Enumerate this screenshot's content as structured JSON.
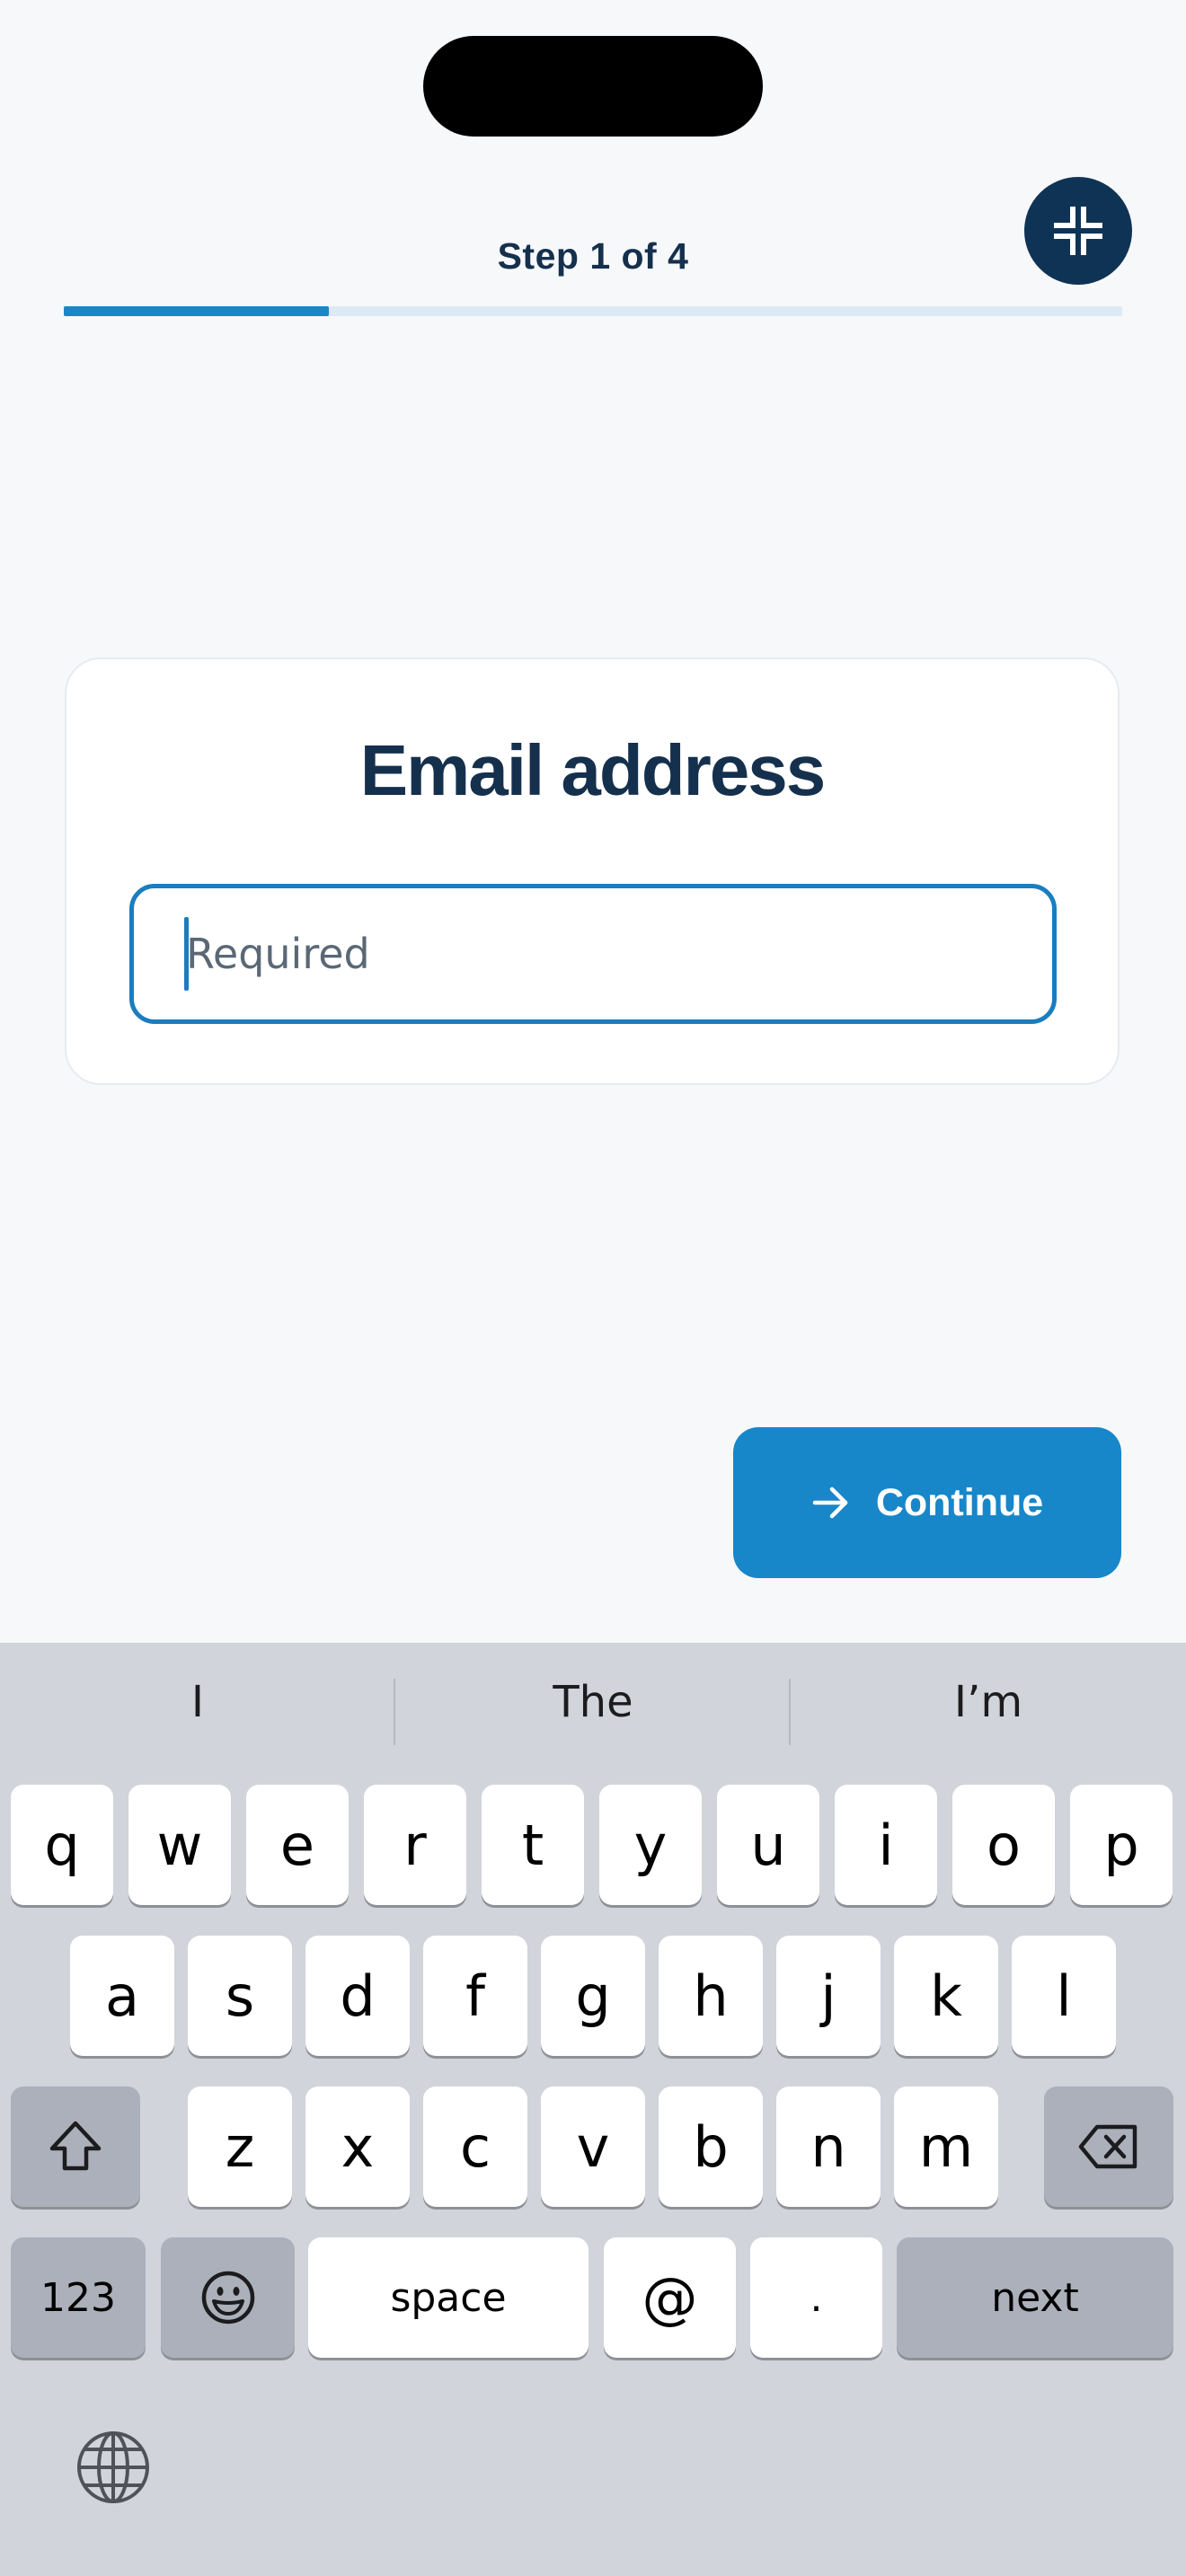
{
  "header": {
    "step_label": "Step 1 of 4",
    "progress_fraction": 0.25,
    "collapse_icon": "collapse-arrows-icon"
  },
  "form": {
    "title": "Email address",
    "email_placeholder": "Required"
  },
  "actions": {
    "continue_label": "Continue",
    "continue_icon": "arrow-right-icon"
  },
  "keyboard": {
    "suggestions": [
      "I",
      "The",
      "I’m"
    ],
    "row1": [
      "q",
      "w",
      "e",
      "r",
      "t",
      "y",
      "u",
      "i",
      "o",
      "p"
    ],
    "row2": [
      "a",
      "s",
      "d",
      "f",
      "g",
      "h",
      "j",
      "k",
      "l"
    ],
    "row3": [
      "z",
      "x",
      "c",
      "v",
      "b",
      "n",
      "m"
    ],
    "numbers_label": "123",
    "space_label": "space",
    "at_label": "@",
    "dot_label": ".",
    "next_label": "next",
    "shift_icon": "shift-icon",
    "delete_icon": "delete-icon",
    "emoji_icon": "emoji-icon",
    "globe_icon": "globe-icon"
  },
  "colors": {
    "accent": "#1787C9",
    "dark_navy": "#0F3355",
    "title_text": "#15304D",
    "background": "#F7F8FA",
    "keyboard_bg": "#D1D4DA"
  }
}
